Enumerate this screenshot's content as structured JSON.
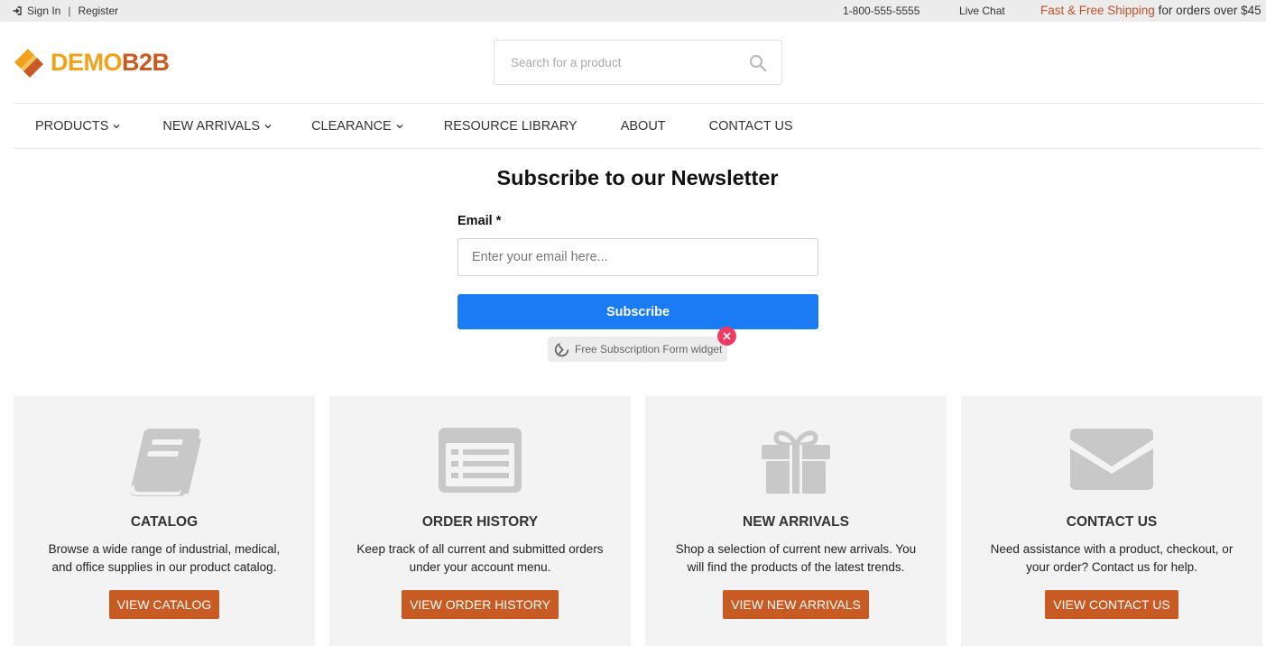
{
  "topbar": {
    "signin_label": "Sign In",
    "separator": "|",
    "register_label": "Register",
    "phone": "1-800-555-5555",
    "live_chat_label": "Live Chat",
    "shipping_accent": "Fast & Free Shipping",
    "shipping_rest": " for orders over $45"
  },
  "header": {
    "logo_demo": "DEMO",
    "logo_b2b": "B2B",
    "search_placeholder": "Search for a product"
  },
  "nav": {
    "items": [
      {
        "label": "Products",
        "has_dropdown": true
      },
      {
        "label": "New Arrivals",
        "has_dropdown": true
      },
      {
        "label": "Clearance",
        "has_dropdown": true
      },
      {
        "label": "Resource Library",
        "has_dropdown": false
      },
      {
        "label": "About",
        "has_dropdown": false
      },
      {
        "label": "Contact Us",
        "has_dropdown": false
      }
    ]
  },
  "newsletter": {
    "title": "Subscribe to our Newsletter",
    "email_label": "Email *",
    "email_placeholder": "Enter your email here...",
    "subscribe_label": "Subscribe",
    "widget_label": "Free Subscription Form widget"
  },
  "cards": [
    {
      "icon": "book-icon",
      "title": "Catalog",
      "description": "Browse a wide range of industrial, medical, and office supplies in our product catalog.",
      "button": "View Catalog"
    },
    {
      "icon": "list-icon",
      "title": "Order History",
      "description": "Keep track of all current and submitted orders under your account menu.",
      "button": "View Order History"
    },
    {
      "icon": "gift-icon",
      "title": "New Arrivals",
      "description": "Shop a selection of current new arrivals. You will find the products of the latest trends.",
      "button": "View New Arrivals"
    },
    {
      "icon": "envelope-icon",
      "title": "Contact Us",
      "description": "Need assistance with a product, checkout, or your order? Contact us for help.",
      "button": "View Contact Us"
    }
  ],
  "colors": {
    "brand_orange": "#c85a23",
    "brand_yellow": "#f0a21b",
    "subscribe_blue": "#1a7cf5",
    "card_bg": "#f3f3f3",
    "icon_gray": "#c8c8c8",
    "close_pink": "#ef3b63"
  }
}
